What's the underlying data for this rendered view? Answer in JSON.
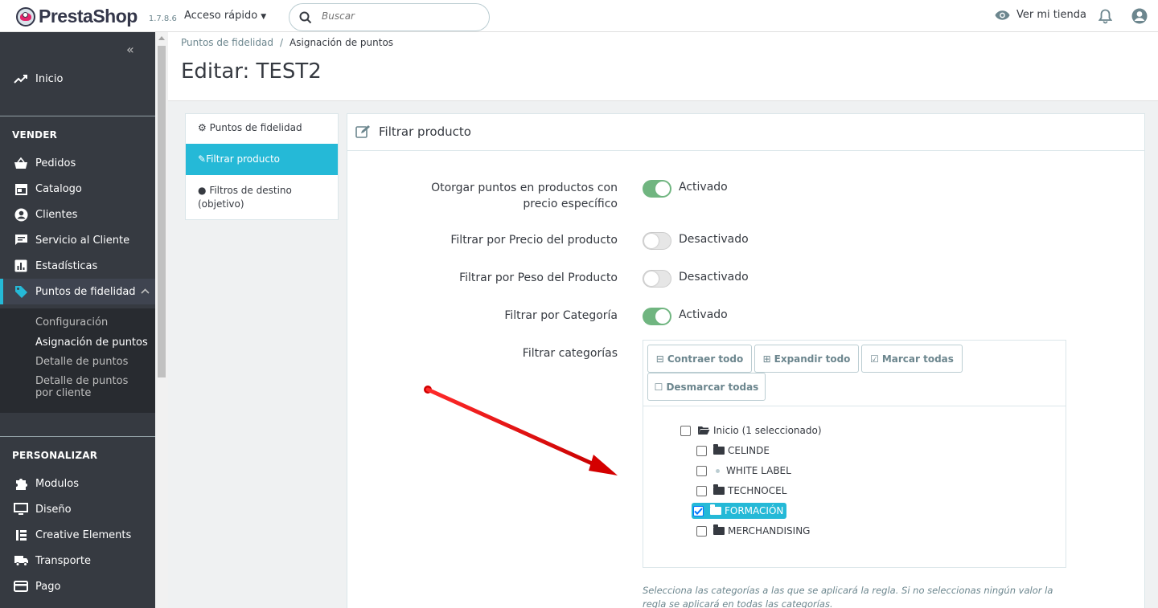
{
  "header": {
    "brand": "PrestaShop",
    "version": "1.7.8.6",
    "quick_access": "Acceso rápido",
    "search_placeholder": "Buscar",
    "view_store": "Ver mi tienda"
  },
  "sidebar": {
    "collapse_glyph": "«",
    "home": "Inicio",
    "sell_title": "VENDER",
    "sell_items": [
      "Pedidos",
      "Catalogo",
      "Clientes",
      "Servicio al Cliente",
      "Estadísticas",
      "Puntos de fidelidad"
    ],
    "submenu": [
      "Configuración",
      "Asignación de puntos",
      "Detalle de puntos",
      "Detalle de puntos por cliente"
    ],
    "customize_title": "PERSONALIZAR",
    "customize_items": [
      "Modulos",
      "Diseño",
      "Creative Elements",
      "Transporte",
      "Pago"
    ]
  },
  "page": {
    "breadcrumb_parent": "Puntos de fidelidad",
    "breadcrumb_sep": "/",
    "breadcrumb_current": "Asignación de puntos",
    "title": "Editar: TEST2"
  },
  "tabs": [
    "Puntos de fidelidad",
    "Filtrar producto",
    "Filtros de destino (objetivo)"
  ],
  "panel": {
    "title": "Filtrar producto",
    "fields": [
      {
        "label": "Otorgar puntos en productos con precio específico",
        "state": "Activado",
        "on": true
      },
      {
        "label": "Filtrar por Precio del producto",
        "state": "Desactivado",
        "on": false
      },
      {
        "label": "Filtrar por Peso del Producto",
        "state": "Desactivado",
        "on": false
      },
      {
        "label": "Filtrar por Categoría",
        "state": "Activado",
        "on": true
      }
    ],
    "categories_label": "Filtrar categorías",
    "tree_buttons": [
      "Contraer todo",
      "Expandir todo",
      "Marcar todas",
      "Desmarcar todas"
    ],
    "tree_root": "Inicio (1 seleccionado)",
    "tree_children": [
      "CELINDE",
      "WHITE LABEL",
      "TECHNOCEL",
      "FORMACIÓN",
      "MERCHANDISING"
    ],
    "help_text": "Selecciona las categorías a las que se aplicará la regla. Si no seleccionas ningún valor la regla se aplicará en todas las categorías."
  },
  "colors": {
    "accent": "#25b9d7",
    "switch_on": "#70b580",
    "sidebar_bg": "#363a41",
    "annotation_arrow": "#e00000"
  }
}
